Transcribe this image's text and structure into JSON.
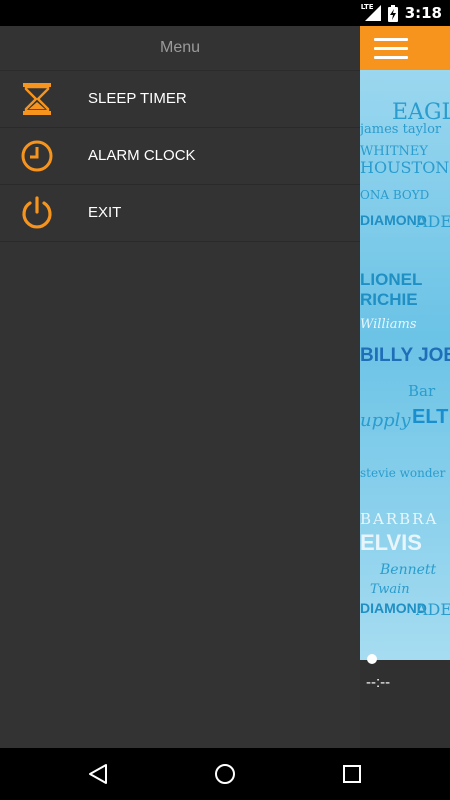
{
  "status_bar": {
    "network": "LTE",
    "time": "3:18",
    "icons": [
      "lte-signal-icon",
      "battery-charging-icon"
    ]
  },
  "drawer": {
    "title": "Menu",
    "items": [
      {
        "label": "SLEEP TIMER",
        "icon": "hourglass-icon"
      },
      {
        "label": "ALARM CLOCK",
        "icon": "clock-icon"
      },
      {
        "label": "EXIT",
        "icon": "power-icon"
      }
    ]
  },
  "content": {
    "menu_icon": "hamburger-menu-icon",
    "artwork_words": [
      "EAGLES",
      "james taylor",
      "WHITNEY",
      "HOUSTON",
      "ONA BOYD",
      "DIAMOND",
      "ADE",
      "LIONEL",
      "RICHIE",
      "Williams",
      "BILLY JOEL",
      "Bar",
      "upply",
      "ELT",
      "stevie wonder",
      "BARBRA",
      "ELVIS",
      "Bennett",
      "Twain"
    ],
    "time_display": "--:--"
  },
  "nav_bar": {
    "buttons": [
      "back-icon",
      "home-icon",
      "recents-icon"
    ]
  },
  "colors": {
    "accent": "#f7941d",
    "drawer_bg": "#333333",
    "artwork_bg": "#6bc3e6"
  }
}
